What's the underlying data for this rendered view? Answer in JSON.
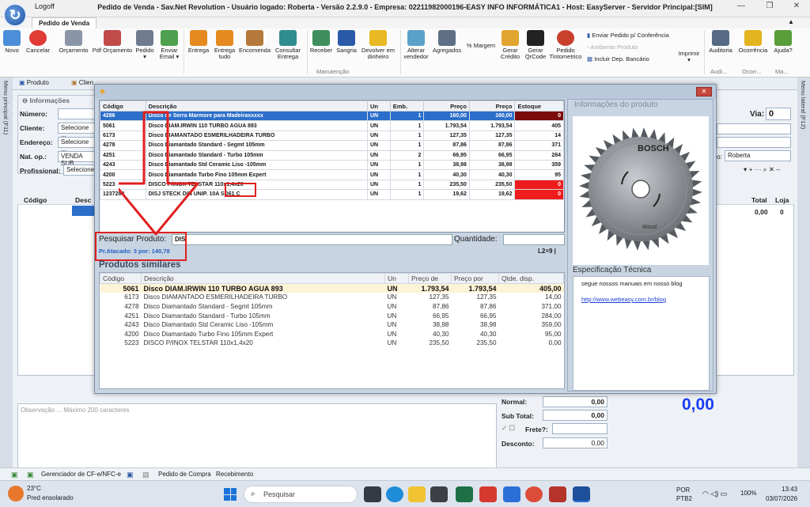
{
  "window": {
    "logoff": "Logoff",
    "title": "Pedido de Venda - Sav.Net Revolution - Usuário logado: Roberta - Versão 2.2.9.0 - Empresa: 02211982000196-EASY INFO INFORMÁTICA1 - Host: EasyServer - Servidor Principal:[SIM]",
    "min": "—",
    "max": "❐",
    "close": "✕"
  },
  "ribbon": {
    "tab": "Pedido de Venda",
    "buttons": [
      "Novo",
      "Cancelar",
      "Orçamento",
      "Pdf Orçamento",
      "Pedido",
      "Enviar Email",
      "Entrega",
      "Entrega tudo",
      "Encomenda",
      "Consultar Entrega",
      "Receber",
      "Sangria",
      "Devolver em dinheiro",
      "Alterar vendedor",
      "Agregados",
      "% Margem",
      "Gerar Crédito",
      "Gerar QrCode",
      "Pedido Tintometrico",
      "Imprimir",
      "Auditoria",
      "Ocorrência",
      "Ajuda?"
    ],
    "side_items": [
      "Enviar Pedido p/ Conferência",
      "Ambiente Produto",
      "Incluir Dep. Bancário"
    ],
    "groups": [
      "Manutenção",
      "Audi...",
      "Ocorr...",
      "Ma..."
    ]
  },
  "side": {
    "left": "Menu principal (F11)",
    "right": "Menu lateral (F12)"
  },
  "main_tabs": [
    "Produto",
    "Clien"
  ],
  "form": {
    "section": "Informações",
    "numero": "Número:",
    "cliente": "Cliente:",
    "cliente_val": "Selecione ...",
    "endereco": "Endereço:",
    "endereco_val": "Selecione ...",
    "natop": "Nat. op.:",
    "natop_val": "VENDA SUB",
    "profissional": "Profissional:",
    "profissional_val": "Selecione",
    "via": "Via:",
    "via_val": "0",
    "vendedor": "o:",
    "vendedor_val": "Roberta",
    "tools": "▾ + ··· ⌕ ✕ –",
    "col_codigo": "Código",
    "col_desc": "Desc",
    "col_total": "Total",
    "col_loja": "Loja",
    "total_val": "0,00",
    "loja_val": "0"
  },
  "dialog": {
    "results_headers": [
      "Código",
      "Descrição",
      "Un",
      "Emb.",
      "Preço",
      "Preço",
      "Estoque"
    ],
    "results": [
      {
        "code": "4286",
        "desc": "Disco de Serra Marmore para Madeiraxxxxx",
        "un": "UN",
        "emb": "1",
        "p1": "160,00",
        "p2": "160,00",
        "stock": "0",
        "stock_style": "dark"
      },
      {
        "code": "5061",
        "desc": "Disco DIAM.IRWIN 110 TURBO AGUA 893",
        "un": "UN",
        "emb": "1",
        "p1": "1.793,54",
        "p2": "1.793,54",
        "stock": "405",
        "stock_style": ""
      },
      {
        "code": "6173",
        "desc": "Disco DIAMANTADO ESMERILHADEIRA TURBO",
        "un": "UN",
        "emb": "1",
        "p1": "127,35",
        "p2": "127,35",
        "stock": "14",
        "stock_style": ""
      },
      {
        "code": "4278",
        "desc": "Disco Diamantado Standard - Segmt 105mm",
        "un": "UN",
        "emb": "1",
        "p1": "87,86",
        "p2": "87,86",
        "stock": "371",
        "stock_style": ""
      },
      {
        "code": "4251",
        "desc": "Disco Diamantado Standard - Turbo 105mm",
        "un": "UN",
        "emb": "2",
        "p1": "66,95",
        "p2": "66,95",
        "stock": "284",
        "stock_style": ""
      },
      {
        "code": "4243",
        "desc": "Disco Diamantado Std Ceramic Liso -105mm",
        "un": "UN",
        "emb": "1",
        "p1": "38,98",
        "p2": "38,98",
        "stock": "359",
        "stock_style": ""
      },
      {
        "code": "4200",
        "desc": "Disco Diamantado Turbo Fino 105mm Expert",
        "un": "UN",
        "emb": "1",
        "p1": "40,30",
        "p2": "40,30",
        "stock": "95",
        "stock_style": ""
      },
      {
        "code": "5223",
        "desc": "DISCO P/INOX TELSTAR 110x1,4x20",
        "un": "UN",
        "emb": "1",
        "p1": "235,50",
        "p2": "235,50",
        "stock": "0",
        "stock_style": "red"
      },
      {
        "code": "1237284",
        "desc": "DISJ STECK DIN UNIP. 10A SD61 C",
        "un": "UN",
        "emb": "1",
        "p1": "19,62",
        "p2": "19,62",
        "stock": "0",
        "stock_style": "red"
      }
    ],
    "search_label": "Pesquisar Produto:",
    "search_value": "DIS",
    "qty_label": "Quantidade:",
    "atacado": "Pr.Atacado: 3 por: 140,78",
    "l2": "L2=9 |",
    "similares_title": "Produtos similares",
    "similar_headers": [
      "Código",
      "Descrição",
      "Un",
      "Preço de",
      "Preço por",
      "Qtde. disp."
    ],
    "similar": [
      {
        "code": "5061",
        "desc": "Disco DIAM.IRWIN 110 TURBO AGUA 893",
        "un": "UN",
        "p1": "1.793,54",
        "p2": "1.793,54",
        "qty": "405,00"
      },
      {
        "code": "6173",
        "desc": "Disco DIAMANTADO ESMERILHADEIRA TURBO",
        "un": "UN",
        "p1": "127,35",
        "p2": "127,35",
        "qty": "14,00"
      },
      {
        "code": "4278",
        "desc": "Disco Diamantado Standard - Segmt 105mm",
        "un": "UN",
        "p1": "87,86",
        "p2": "87,86",
        "qty": "371,00"
      },
      {
        "code": "4251",
        "desc": "Disco Diamantado Standard - Turbo 105mm",
        "un": "UN",
        "p1": "66,95",
        "p2": "66,95",
        "qty": "284,00"
      },
      {
        "code": "4243",
        "desc": "Disco Diamantado Std Ceramic Liso -105mm",
        "un": "UN",
        "p1": "38,98",
        "p2": "38,98",
        "qty": "359,00"
      },
      {
        "code": "4200",
        "desc": "Disco Diamantado Turbo Fino 105mm Expert",
        "un": "UN",
        "p1": "40,30",
        "p2": "40,30",
        "qty": "95,00"
      },
      {
        "code": "5223",
        "desc": "DISCO P/INOX TELSTAR 110x1,4x20",
        "un": "UN",
        "p1": "235,50",
        "p2": "235,50",
        "qty": "0,00"
      }
    ],
    "info_title": "Informações do produto",
    "brand": "BOSCH",
    "blade_sub": "Wood",
    "spec_title": "Especificação Técnica",
    "spec_text": "segue nossos manuais em nosso blog",
    "spec_link": "http://www.webeasy.com.br/blog"
  },
  "bottom": {
    "obs_placeholder": "Observação ... Máximo 200 caracteres",
    "normal": "Normal:",
    "normal_val": "0,00",
    "subtotal": "Sub Total:",
    "subtotal_val": "0,00",
    "frete": "Frete?:",
    "desconto": "Desconto:",
    "desconto_val": "0,00",
    "big_total": "0,00"
  },
  "statusbar": {
    "item1": "Gerenciador de CF-e/NFC-e",
    "item2": "Pedido de Compra",
    "item3": "Recebimento"
  },
  "taskbar": {
    "temp": "23°C",
    "weather": "Pred ensolarado",
    "search": "Pesquisar",
    "lang1": "POR",
    "lang2": "PTB2",
    "battery": "100%",
    "time": "13:43",
    "date": "03/07/2026"
  }
}
